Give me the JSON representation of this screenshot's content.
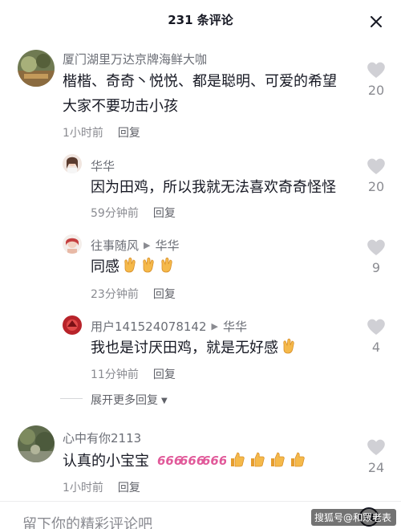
{
  "header": {
    "title": "231 条评论"
  },
  "comments": [
    {
      "author": "厦门湖里万达京牌海鲜大咖",
      "text_line1": "楷楷、奇奇丶悦悦、都是聪明、可爱的希望",
      "text_line2": "大家不要功击小孩",
      "time": "1小时前",
      "reply_label": "回复",
      "likes": "20"
    }
  ],
  "replies": [
    {
      "author": "华华",
      "text": "因为田鸡，所以我就无法喜欢奇奇怪怪",
      "time": "59分钟前",
      "reply_label": "回复",
      "likes": "20"
    },
    {
      "author": "往事随风",
      "reply_to": "华华",
      "text": "同感",
      "time": "23分钟前",
      "reply_label": "回复",
      "likes": "9"
    },
    {
      "author": "用户141524078142",
      "reply_to": "华华",
      "text": "我也是讨厌田鸡，就是无好感",
      "time": "11分钟前",
      "reply_label": "回复",
      "likes": "4"
    }
  ],
  "expand": {
    "label": "展开更多回复"
  },
  "comment2": {
    "author": "心中有你2113",
    "text": "认真的小宝宝",
    "time": "1小时前",
    "reply_label": "回复",
    "likes": "24"
  },
  "bottom": {
    "placeholder": "留下你的精彩评论吧"
  },
  "watermark": {
    "text": "搜狐号@和眾老表"
  },
  "icons": {
    "close": "close-icon",
    "heart": "heart-icon",
    "at": "at-icon",
    "ok_hand_emoji": "ok-hand-emoji",
    "thumbs_up_emoji": "thumbs-up-emoji",
    "sticker_666": "666-sticker"
  },
  "colors": {
    "heart_gray": "#d0d0d5",
    "muted_text": "#8a8b91",
    "sticker_pink": "#e15a9a"
  }
}
